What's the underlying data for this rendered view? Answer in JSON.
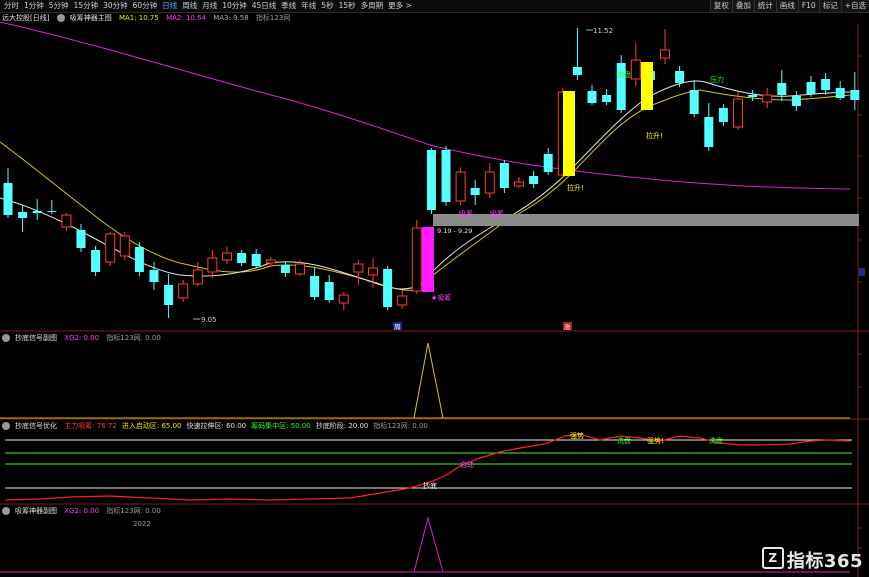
{
  "toolbar": {
    "periods": [
      "分时",
      "1分钟",
      "5分钟",
      "15分钟",
      "30分钟",
      "60分钟",
      "日线",
      "周线",
      "月线",
      "10分钟",
      "45日线",
      "季线",
      "年线",
      "5秒",
      "15秒",
      "多周期",
      "更多 >"
    ],
    "active_period": "日线",
    "right_buttons": [
      "复权",
      "叠加",
      "统计",
      "画线",
      "F10",
      "标记",
      "+自选"
    ]
  },
  "main_header": {
    "left_label": "远大控股[日线]",
    "indicator_name": "吸筹神器主图",
    "ma1_label": "MA1: 10.75",
    "ma2_label": "MA2: 10.64",
    "ma3_label": "MA3: 9.58",
    "credit": "指标123网",
    "colors": {
      "ma1": "#e6e600",
      "ma2": "#ff40ff",
      "ma3": "#b0b0b0"
    }
  },
  "main_annotations": {
    "low_price": "9.05",
    "high_price": "11.52",
    "band_label": "9.19 - 9.29",
    "tag_buy": "★吸筹",
    "tag_rise1": "拉升!",
    "tag_rise2": "拉升!",
    "tag_wash": "洗盘",
    "tag_wash2": "洗盘",
    "tag_pressure": "压力",
    "tag_pressure2": "压力",
    "tag_small1": "吸筹",
    "tag_small2": "吸筹",
    "date_marker1": "周",
    "date_marker2": "涨"
  },
  "panel2": {
    "name": "抄底信号副图",
    "xg_label": "XG2: 0.00",
    "credit": "指标123网: 0.00"
  },
  "panel3": {
    "name": "抄底信号优化",
    "items": [
      {
        "label": "主力吸筹: 76.72",
        "color": "#ff3b3b"
      },
      {
        "label": "进入启动区: 65.00",
        "color": "#ffe000"
      },
      {
        "label": "快速拉伸区: 60.00",
        "color": "#e0e0e0"
      },
      {
        "label": "筹码集中区: 50.00",
        "color": "#2cff2c"
      },
      {
        "label": "抄底阶段: 20.00",
        "color": "#e0e0e0"
      },
      {
        "label": "指标123网: 0.00",
        "color": "#9a9a9a"
      }
    ],
    "tags": {
      "bottom": "抄底",
      "breakout": "启动",
      "t1": "强势",
      "t2": "洗盘",
      "t3": "强势!",
      "t4": "洗盘"
    }
  },
  "panel4": {
    "name": "吸筹神器副图",
    "xg_label": "XG2: 0.00",
    "credit": "指标123网: 0.00",
    "year": "2022"
  },
  "watermark": {
    "text": "指标365",
    "logo": "Z"
  },
  "candles": [
    {
      "o": 183,
      "c": 215,
      "h": 168,
      "l": 218
    },
    {
      "o": 212,
      "c": 218,
      "h": 205,
      "l": 232
    },
    {
      "o": 211,
      "c": 213,
      "h": 199,
      "l": 220
    },
    {
      "o": 211,
      "c": 212,
      "h": 200,
      "l": 214
    },
    {
      "o": 227,
      "c": 215,
      "h": 213,
      "l": 231
    },
    {
      "o": 230,
      "c": 248,
      "h": 224,
      "l": 252
    },
    {
      "o": 250,
      "c": 272,
      "h": 246,
      "l": 276
    },
    {
      "o": 262,
      "c": 234,
      "h": 232,
      "l": 266
    },
    {
      "o": 256,
      "c": 236,
      "h": 232,
      "l": 260
    },
    {
      "o": 247,
      "c": 272,
      "h": 242,
      "l": 276
    },
    {
      "o": 270,
      "c": 282,
      "h": 262,
      "l": 290
    },
    {
      "o": 285,
      "c": 305,
      "h": 274,
      "l": 318
    },
    {
      "o": 298,
      "c": 284,
      "h": 280,
      "l": 302
    },
    {
      "o": 284,
      "c": 270,
      "h": 262,
      "l": 286
    },
    {
      "o": 272,
      "c": 258,
      "h": 250,
      "l": 278
    },
    {
      "o": 260,
      "c": 253,
      "h": 246,
      "l": 264
    },
    {
      "o": 253,
      "c": 263,
      "h": 250,
      "l": 266
    },
    {
      "o": 254,
      "c": 266,
      "h": 249,
      "l": 268
    },
    {
      "o": 263,
      "c": 260,
      "h": 257,
      "l": 266
    },
    {
      "o": 265,
      "c": 273,
      "h": 262,
      "l": 277
    },
    {
      "o": 274,
      "c": 264,
      "h": 260,
      "l": 276
    },
    {
      "o": 276,
      "c": 297,
      "h": 267,
      "l": 300
    },
    {
      "o": 282,
      "c": 300,
      "h": 275,
      "l": 303
    },
    {
      "o": 303,
      "c": 295,
      "h": 292,
      "l": 310
    },
    {
      "o": 272,
      "c": 264,
      "h": 260,
      "l": 285
    },
    {
      "o": 275,
      "c": 268,
      "h": 258,
      "l": 288
    },
    {
      "o": 269,
      "c": 307,
      "h": 266,
      "l": 310
    },
    {
      "o": 305,
      "c": 296,
      "h": 290,
      "l": 309
    },
    {
      "o": 291,
      "c": 228,
      "h": 220,
      "l": 294
    },
    {
      "o": 150,
      "c": 210,
      "h": 148,
      "l": 214
    },
    {
      "o": 150,
      "c": 202,
      "h": 146,
      "l": 206
    },
    {
      "o": 201,
      "c": 172,
      "h": 167,
      "l": 205
    },
    {
      "o": 188,
      "c": 195,
      "h": 180,
      "l": 205
    },
    {
      "o": 193,
      "c": 172,
      "h": 163,
      "l": 198
    },
    {
      "o": 163,
      "c": 188,
      "h": 160,
      "l": 193
    },
    {
      "o": 186,
      "c": 182,
      "h": 177,
      "l": 188
    },
    {
      "o": 176,
      "c": 184,
      "h": 171,
      "l": 188
    },
    {
      "o": 154,
      "c": 172,
      "h": 148,
      "l": 175
    },
    {
      "o": 175,
      "c": 92,
      "h": 88,
      "l": 178
    },
    {
      "o": 67,
      "c": 75,
      "h": 28,
      "l": 80
    },
    {
      "o": 91,
      "c": 103,
      "h": 85,
      "l": 105
    },
    {
      "o": 95,
      "c": 102,
      "h": 89,
      "l": 105
    },
    {
      "o": 63,
      "c": 110,
      "h": 55,
      "l": 113
    },
    {
      "o": 79,
      "c": 60,
      "h": 43,
      "l": 86
    },
    {
      "o": 71,
      "c": 80,
      "h": 64,
      "l": 84
    },
    {
      "o": 58,
      "c": 50,
      "h": 29,
      "l": 64
    },
    {
      "o": 71,
      "c": 83,
      "h": 66,
      "l": 87
    },
    {
      "o": 90,
      "c": 114,
      "h": 80,
      "l": 117
    },
    {
      "o": 117,
      "c": 147,
      "h": 103,
      "l": 151
    },
    {
      "o": 108,
      "c": 122,
      "h": 104,
      "l": 126
    },
    {
      "o": 127,
      "c": 99,
      "h": 92,
      "l": 130
    },
    {
      "o": 95,
      "c": 97,
      "h": 90,
      "l": 101
    },
    {
      "o": 102,
      "c": 95,
      "h": 88,
      "l": 108
    },
    {
      "o": 83,
      "c": 95,
      "h": 70,
      "l": 101
    },
    {
      "o": 96,
      "c": 106,
      "h": 91,
      "l": 111
    },
    {
      "o": 82,
      "c": 94,
      "h": 76,
      "l": 97
    },
    {
      "o": 79,
      "c": 90,
      "h": 73,
      "l": 95
    },
    {
      "o": 88,
      "c": 98,
      "h": 81,
      "l": 100
    },
    {
      "o": 90,
      "c": 100,
      "h": 72,
      "l": 110
    }
  ]
}
